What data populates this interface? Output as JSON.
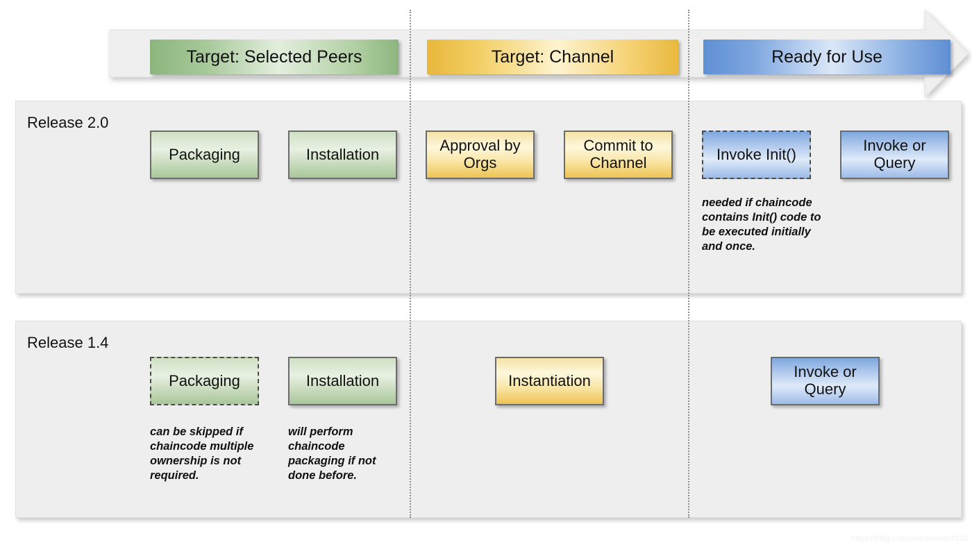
{
  "banner": {
    "phases": [
      {
        "label": "Target: Selected Peers",
        "color": "#a6c899"
      },
      {
        "label": "Target: Channel",
        "color": "#f2ce63"
      },
      {
        "label": "Ready for Use",
        "color": "#7da6df"
      }
    ]
  },
  "rows": [
    {
      "label": "Release 2.0",
      "steps": [
        {
          "label": "Packaging",
          "style": "green",
          "border": "solid"
        },
        {
          "label": "Installation",
          "style": "green",
          "border": "solid"
        },
        {
          "label": "Approval by Orgs",
          "style": "yellow",
          "border": "solid"
        },
        {
          "label": "Commit to Channel",
          "style": "yellow",
          "border": "solid"
        },
        {
          "label": "Invoke Init()",
          "style": "blue",
          "border": "dashed"
        },
        {
          "label": "Invoke or Query",
          "style": "blue",
          "border": "solid"
        }
      ],
      "annotations": [
        {
          "text": "needed if chaincode contains Init() code to be executed initially and once."
        }
      ]
    },
    {
      "label": "Release 1.4",
      "steps": [
        {
          "label": "Packaging",
          "style": "green",
          "border": "dashed"
        },
        {
          "label": "Installation",
          "style": "green",
          "border": "solid"
        },
        {
          "label": "Instantiation",
          "style": "yellow",
          "border": "solid"
        },
        {
          "label": "Invoke or Query",
          "style": "blue",
          "border": "solid"
        }
      ],
      "annotations": [
        {
          "text": "can be skipped if chaincode multiple ownership is not required."
        },
        {
          "text": "will perform chaincode packaging if not done before."
        }
      ]
    }
  ],
  "watermark": "https://blog.csdn.net/shebao3333"
}
